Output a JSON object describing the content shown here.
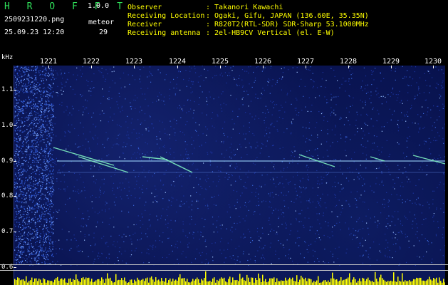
{
  "header": {
    "app_name": "H R O F F T",
    "version": "1.0.0",
    "filename": "2509231220.png",
    "meteor_label": "meteor",
    "datetime": "25.09.23 12:20",
    "meteor_count": "29"
  },
  "info": {
    "observer_key": "Observer",
    "observer_val": ": Takanori Kawachi",
    "location_key": "Receiving Location",
    "location_val": ": Ogaki, Gifu, JAPAN (136.60E, 35.35N)",
    "receiver_key": "Receiver",
    "receiver_val": ": R820T2(RTL-SDR) SDR-Sharp 53.1000MHz",
    "antenna_key": "Receiving antenna",
    "antenna_val": ": 2el-HB9CV Vertical (el. E-W)"
  },
  "axes": {
    "y_unit": "kHz",
    "x_ticks": [
      "1221",
      "1222",
      "1223",
      "1224",
      "1225",
      "1226",
      "1227",
      "1228",
      "1229",
      "1230"
    ],
    "y_ticks": [
      "1.1",
      "1.0",
      "0.9",
      "0.8",
      "0.7",
      "0.6"
    ]
  },
  "colors": {
    "logo": "#2fe05a",
    "info_text": "#ffff00",
    "background": "#07104a",
    "carrier": "#9fd8ff",
    "meteor_trail": "#7ff0c0",
    "level_bar": "#ffff00"
  }
}
